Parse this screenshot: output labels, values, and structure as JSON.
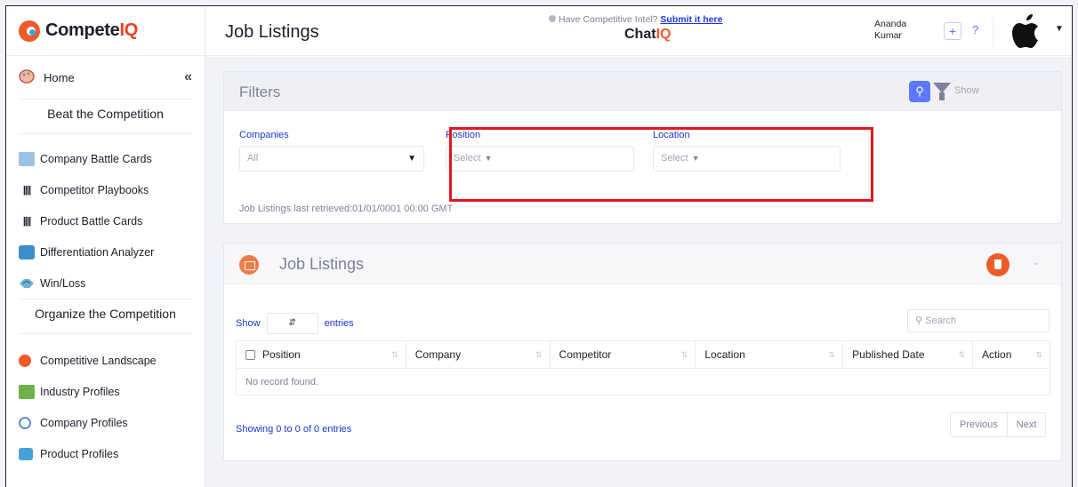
{
  "brand": {
    "name_prefix": "Compete",
    "name_suffix": "IQ"
  },
  "sidebar": {
    "home_label": "Home",
    "section1": "Beat the Competition",
    "items1": [
      {
        "label": "Company Battle Cards"
      },
      {
        "label": "Competitor Playbooks"
      },
      {
        "label": "Product Battle Cards"
      },
      {
        "label": "Differentiation Analyzer"
      },
      {
        "label": "Win/Loss"
      }
    ],
    "section2": "Organize the Competition",
    "items2": [
      {
        "label": "Competitive Landscape"
      },
      {
        "label": "Industry Profiles"
      },
      {
        "label": "Company Profiles"
      },
      {
        "label": "Product Profiles"
      }
    ]
  },
  "header": {
    "page_title": "Job Listings",
    "intel_text": "Have Competitive Intel?",
    "intel_link": "Submit it here",
    "chat_prefix": "Chat",
    "chat_suffix": "IQ",
    "user_first": "Ananda",
    "user_last": "Kumar",
    "plus": "+",
    "help": "?"
  },
  "filters": {
    "title": "Filters",
    "show_label": "Show",
    "companies_label": "Companies",
    "companies_value": "All",
    "position_label": "Position",
    "position_value": "Select",
    "location_label": "Location",
    "location_value": "Select",
    "retrieved": "Job Listings last retrieved:01/01/0001 00:00 GMT"
  },
  "jobs": {
    "title": "Job Listings",
    "show": "Show",
    "entries": "entries",
    "search_placeholder": "Search",
    "columns": [
      "Position",
      "Company",
      "Competitor",
      "Location",
      "Published Date",
      "Action"
    ],
    "empty": "No record found.",
    "showing": "Showing 0 to 0 of 0 entries",
    "prev": "Previous",
    "next": "Next"
  },
  "colors": {
    "accent": "#5d78ff",
    "brand_orange": "#ef5a29",
    "highlight_red": "#e3161e",
    "link_blue": "#1a37d6"
  }
}
